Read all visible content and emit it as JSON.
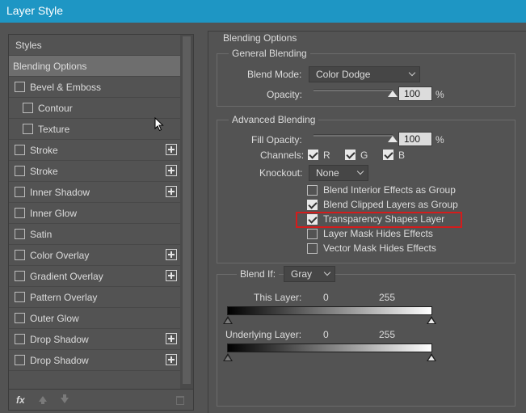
{
  "window": {
    "title": "Layer Style"
  },
  "styles_panel": {
    "header": "Styles",
    "items": [
      {
        "label": "Blending Options",
        "has_checkbox": false,
        "checked": false,
        "indent": false,
        "has_plus": false,
        "selected": true
      },
      {
        "label": "Bevel & Emboss",
        "has_checkbox": true,
        "checked": false,
        "indent": false,
        "has_plus": false,
        "selected": false
      },
      {
        "label": "Contour",
        "has_checkbox": true,
        "checked": false,
        "indent": true,
        "has_plus": false,
        "selected": false
      },
      {
        "label": "Texture",
        "has_checkbox": true,
        "checked": false,
        "indent": true,
        "has_plus": false,
        "selected": false
      },
      {
        "label": "Stroke",
        "has_checkbox": true,
        "checked": false,
        "indent": false,
        "has_plus": true,
        "selected": false
      },
      {
        "label": "Stroke",
        "has_checkbox": true,
        "checked": false,
        "indent": false,
        "has_plus": true,
        "selected": false
      },
      {
        "label": "Inner Shadow",
        "has_checkbox": true,
        "checked": false,
        "indent": false,
        "has_plus": true,
        "selected": false
      },
      {
        "label": "Inner Glow",
        "has_checkbox": true,
        "checked": false,
        "indent": false,
        "has_plus": false,
        "selected": false
      },
      {
        "label": "Satin",
        "has_checkbox": true,
        "checked": false,
        "indent": false,
        "has_plus": false,
        "selected": false
      },
      {
        "label": "Color Overlay",
        "has_checkbox": true,
        "checked": false,
        "indent": false,
        "has_plus": true,
        "selected": false
      },
      {
        "label": "Gradient Overlay",
        "has_checkbox": true,
        "checked": false,
        "indent": false,
        "has_plus": true,
        "selected": false
      },
      {
        "label": "Pattern Overlay",
        "has_checkbox": true,
        "checked": false,
        "indent": false,
        "has_plus": false,
        "selected": false
      },
      {
        "label": "Outer Glow",
        "has_checkbox": true,
        "checked": false,
        "indent": false,
        "has_plus": false,
        "selected": false
      },
      {
        "label": "Drop Shadow",
        "has_checkbox": true,
        "checked": false,
        "indent": false,
        "has_plus": true,
        "selected": false
      },
      {
        "label": "Drop Shadow",
        "has_checkbox": true,
        "checked": false,
        "indent": false,
        "has_plus": true,
        "selected": false
      }
    ],
    "fx_label": "fx"
  },
  "blending": {
    "section_title": "Blending Options",
    "general": {
      "title": "General Blending",
      "blend_mode_label": "Blend Mode:",
      "blend_mode_value": "Color Dodge",
      "opacity_label": "Opacity:",
      "opacity_value": "100",
      "opacity_unit": "%",
      "opacity_fraction": 1.0
    },
    "advanced": {
      "title": "Advanced Blending",
      "fill_opacity_label": "Fill Opacity:",
      "fill_opacity_value": "100",
      "fill_opacity_unit": "%",
      "fill_opacity_fraction": 1.0,
      "channels_label": "Channels:",
      "channels": [
        {
          "label": "R",
          "checked": true
        },
        {
          "label": "G",
          "checked": true
        },
        {
          "label": "B",
          "checked": true
        }
      ],
      "knockout_label": "Knockout:",
      "knockout_value": "None",
      "options": [
        {
          "label": "Blend Interior Effects as Group",
          "checked": false,
          "highlighted": false
        },
        {
          "label": "Blend Clipped Layers as Group",
          "checked": true,
          "highlighted": false
        },
        {
          "label": "Transparency Shapes Layer",
          "checked": true,
          "highlighted": true
        },
        {
          "label": "Layer Mask Hides Effects",
          "checked": false,
          "highlighted": false
        },
        {
          "label": "Vector Mask Hides Effects",
          "checked": false,
          "highlighted": false
        }
      ]
    },
    "blend_if": {
      "label": "Blend If:",
      "value": "Gray",
      "this_layer_label": "This Layer:",
      "this_layer_min": "0",
      "this_layer_max": "255",
      "underlying_label": "Underlying Layer:",
      "underlying_min": "0",
      "underlying_max": "255"
    }
  },
  "colors": {
    "title_bar": "#1e96c4",
    "highlight": "#d41c1c",
    "panel_bg": "#535353"
  }
}
